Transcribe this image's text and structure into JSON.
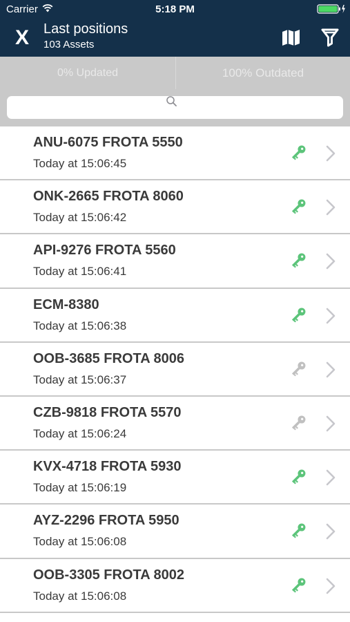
{
  "status_bar": {
    "carrier": "Carrier",
    "time": "5:18 PM"
  },
  "nav": {
    "close_label": "X",
    "title": "Last positions",
    "subtitle": "103 Assets",
    "icons": [
      "map-icon",
      "filter-icon"
    ]
  },
  "tabs": [
    {
      "label": "0% Updated"
    },
    {
      "label": "100% Outdated"
    }
  ],
  "search": {
    "placeholder": ""
  },
  "colors": {
    "header_bg": "#14304a",
    "key_active": "#5cc47a",
    "key_inactive": "#c0c0c0",
    "tab_bg": "#c9c9c9"
  },
  "assets": [
    {
      "name": "ANU-6075 FROTA 5550",
      "time": "Today at 15:06:45",
      "key_status": "active"
    },
    {
      "name": "ONK-2665 FROTA 8060",
      "time": "Today at 15:06:42",
      "key_status": "active"
    },
    {
      "name": "API-9276 FROTA 5560",
      "time": "Today at 15:06:41",
      "key_status": "active"
    },
    {
      "name": "ECM-8380",
      "time": "Today at 15:06:38",
      "key_status": "active"
    },
    {
      "name": "OOB-3685 FROTA 8006",
      "time": "Today at 15:06:37",
      "key_status": "inactive"
    },
    {
      "name": "CZB-9818 FROTA 5570",
      "time": "Today at 15:06:24",
      "key_status": "inactive"
    },
    {
      "name": "KVX-4718 FROTA 5930",
      "time": "Today at 15:06:19",
      "key_status": "active"
    },
    {
      "name": "AYZ-2296 FROTA 5950",
      "time": "Today at 15:06:08",
      "key_status": "active"
    },
    {
      "name": "OOB-3305 FROTA 8002",
      "time": "Today at 15:06:08",
      "key_status": "active"
    }
  ]
}
